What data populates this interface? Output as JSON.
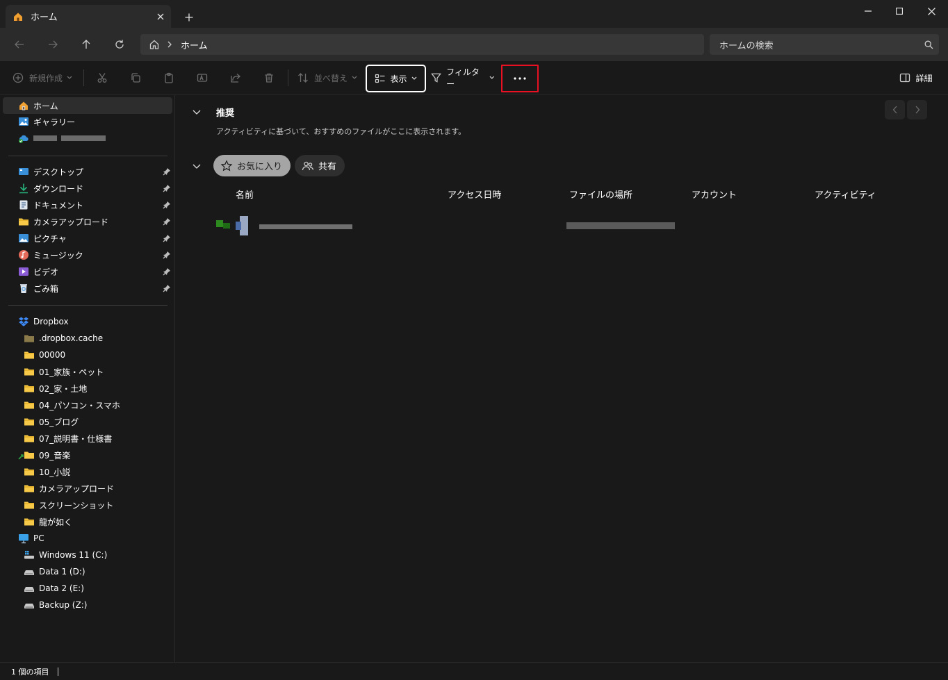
{
  "window": {
    "tab_title": "ホーム",
    "controls": [
      "minimize",
      "maximize",
      "close"
    ]
  },
  "address": {
    "path": "ホーム",
    "search_placeholder": "ホームの検索"
  },
  "toolbar": {
    "new_label": "新規作成",
    "sort_label": "並べ替え",
    "view_label": "表示",
    "filter_label": "フィルター",
    "more_label": "...",
    "details_label": "詳細"
  },
  "sidebar": {
    "top": [
      {
        "label": "ホーム",
        "icon": "home-icon",
        "selected": true
      },
      {
        "label": "ギャラリー",
        "icon": "gallery-icon"
      }
    ],
    "pinned": [
      {
        "label": "デスクトップ",
        "icon": "desktop-icon"
      },
      {
        "label": "ダウンロード",
        "icon": "download-icon"
      },
      {
        "label": "ドキュメント",
        "icon": "documents-icon"
      },
      {
        "label": "カメラアップロード",
        "icon": "folder-icon"
      },
      {
        "label": "ピクチャ",
        "icon": "pictures-icon"
      },
      {
        "label": "ミュージック",
        "icon": "music-icon"
      },
      {
        "label": "ビデオ",
        "icon": "videos-icon"
      },
      {
        "label": "ごみ箱",
        "icon": "recycle-bin-icon"
      }
    ],
    "dropbox": {
      "label": "Dropbox",
      "children": [
        ".dropbox.cache",
        "00000",
        "01_家族・ペット",
        "02_家・土地",
        "04_パソコン・スマホ",
        "05_ブログ",
        "07_説明書・仕様書",
        "09_音楽",
        "10_小説",
        "カメラアップロード",
        "スクリーンショット",
        "龍が如く"
      ]
    },
    "pc": {
      "label": "PC",
      "drives": [
        "Windows 11 (C:)",
        "Data 1 (D:)",
        "Data 2 (E:)",
        "Backup (Z:)"
      ]
    }
  },
  "main": {
    "recommended": {
      "title": "推奨",
      "description": "アクティビティに基づいて、おすすめのファイルがここに表示されます。"
    },
    "tabs": [
      {
        "label": "お気に入り",
        "active": true
      },
      {
        "label": "共有",
        "active": false
      }
    ],
    "columns": [
      "名前",
      "アクセス日時",
      "ファイルの場所",
      "アカウント",
      "アクティビティ"
    ]
  },
  "status": {
    "item_count": "1 個の項目"
  },
  "colors": {
    "background": "#191919",
    "toolbar": "#2b2b2b",
    "input": "#373737",
    "folder": "#f7c948",
    "highlight": "#e81123"
  }
}
